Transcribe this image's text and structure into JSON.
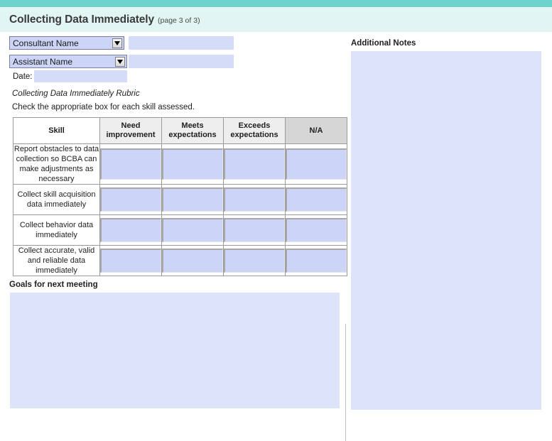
{
  "header": {
    "title": "Collecting Data Immediately",
    "page_indicator": "(page 3 of 3)",
    "strip_color": "#6ed3cc",
    "band_color": "#e1f5f2"
  },
  "form": {
    "consultant": {
      "select_label": "Consultant Name",
      "select_value": "Consultant Name",
      "input_value": "",
      "input_placeholder": ""
    },
    "assistant": {
      "select_label": "Assistant Name",
      "select_value": "Assistant Name",
      "input_value": "",
      "input_placeholder": ""
    },
    "date": {
      "label": "Date:",
      "value": "",
      "placeholder": ""
    }
  },
  "rubric": {
    "caption": "Collecting Data Immediately Rubric",
    "instruction": "Check the appropriate box for each skill assessed.",
    "columns": [
      "Skill",
      "Need improvement",
      "Meets expectations",
      "Exceeds expectations",
      "N/A"
    ],
    "rows": [
      {
        "skill": "Report obstacles to data collection so BCBA can make adjustments as necessary",
        "values": [
          "",
          "",
          "",
          ""
        ]
      },
      {
        "skill": "Collect skill acquisition data immediately",
        "values": [
          "",
          "",
          "",
          ""
        ]
      },
      {
        "skill": "Collect behavior data immediately",
        "values": [
          "",
          "",
          "",
          ""
        ]
      },
      {
        "skill": "Collect accurate, valid and reliable data immediately",
        "values": [
          "",
          "",
          "",
          ""
        ]
      }
    ],
    "header_bg": "#eeeeee",
    "na_header_bg": "#d6d6d6",
    "field_bg": "#ccd4f7"
  },
  "goals": {
    "label": "Goals for next meeting",
    "value": "",
    "placeholder": ""
  },
  "notes": {
    "label": "Additional Notes",
    "value": "",
    "placeholder": ""
  }
}
